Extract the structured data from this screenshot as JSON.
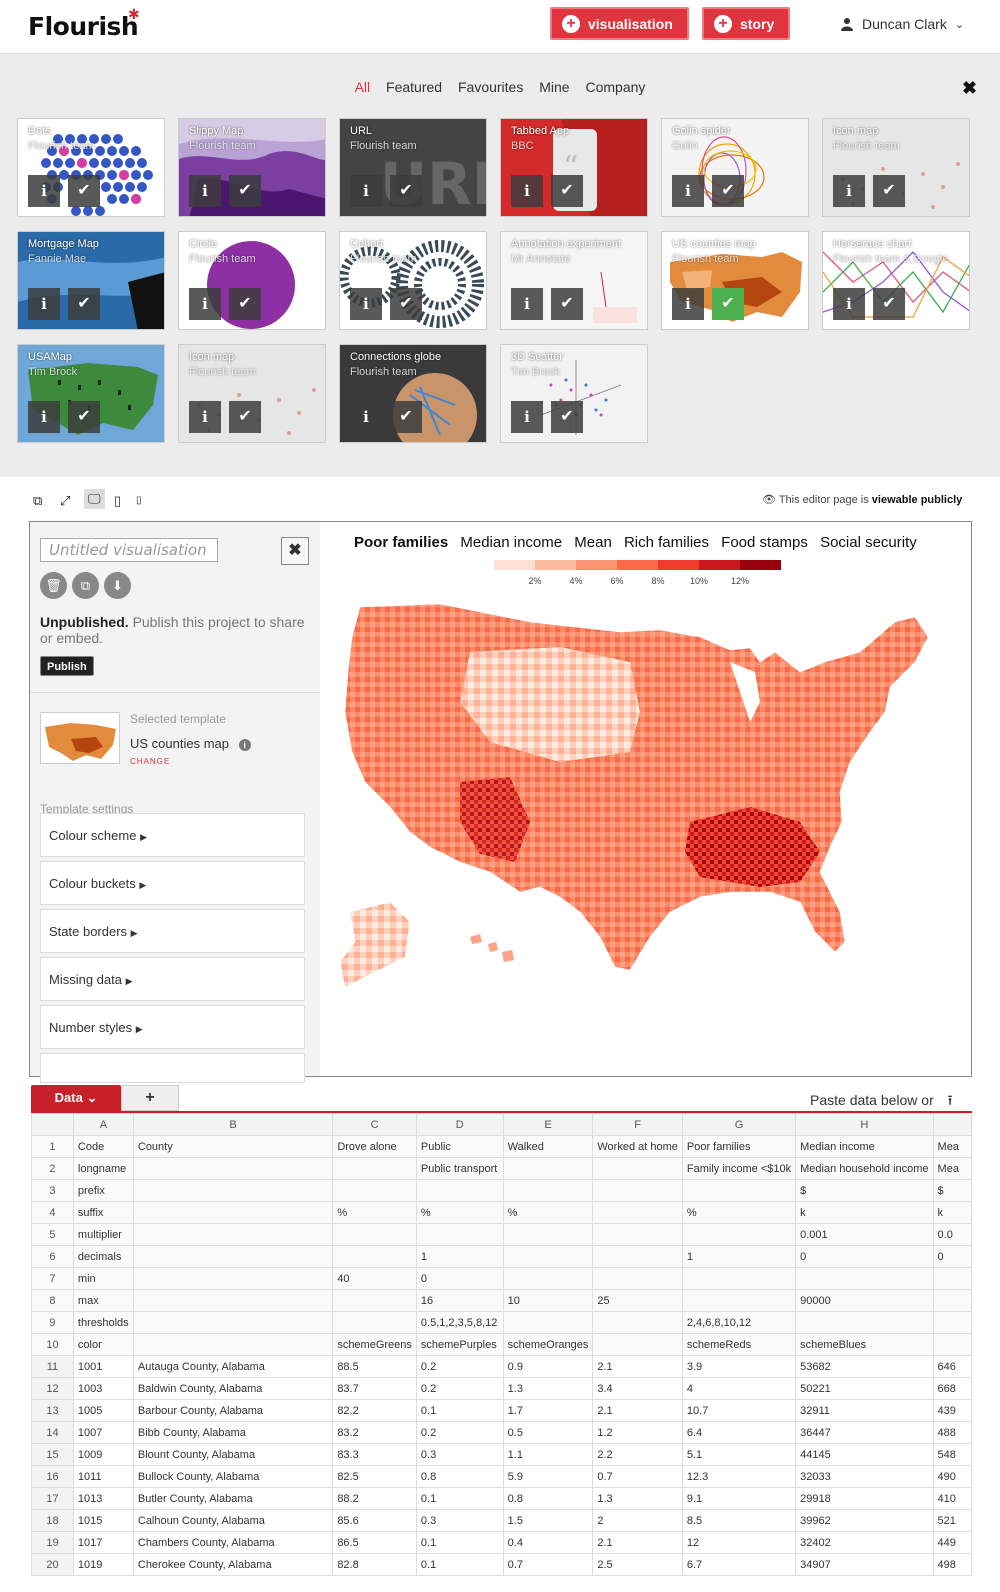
{
  "header": {
    "logo": "Flourish",
    "new_vis_label": "visualisation",
    "new_story_label": "story",
    "user_name": "Duncan Clark"
  },
  "gallery": {
    "filters": [
      "All",
      "Featured",
      "Favourites",
      "Mine",
      "Company"
    ],
    "active_filter": "All",
    "templates": [
      {
        "name": "Dots",
        "author": "Flourish team"
      },
      {
        "name": "Slippy Map",
        "author": "Flourish team"
      },
      {
        "name": "URL",
        "author": "Flourish team"
      },
      {
        "name": "Tabbed App",
        "author": "BBC"
      },
      {
        "name": "Golin spider",
        "author": "Golin"
      },
      {
        "name": "Icon map",
        "author": "Flourish team"
      },
      {
        "name": "Mortgage Map",
        "author": "Fannie Mae"
      },
      {
        "name": "Circle",
        "author": "Flourish team"
      },
      {
        "name": "Cohort",
        "author": "Flourish team"
      },
      {
        "name": "Annotation experiment",
        "author": "Mr Annotate"
      },
      {
        "name": "US counties map",
        "author": "Flourish team"
      },
      {
        "name": "Horserace chart",
        "author": "Flourish team & Google"
      },
      {
        "name": "USAMap",
        "author": "Tim Brock"
      },
      {
        "name": "Icon map",
        "author": "Flourish team"
      },
      {
        "name": "Connections globe",
        "author": "Flourish team"
      },
      {
        "name": "3D Scatter",
        "author": "Tim Brock"
      }
    ]
  },
  "toolbar": {
    "public_prefix": "This editor page is",
    "public_strong": "viewable publicly"
  },
  "editor": {
    "title_placeholder": "Untitled visualisation",
    "unpublished_strong": "Unpublished.",
    "unpublished_text": "Publish this project to share or embed.",
    "publish_label": "Publish",
    "selected_template_label": "Selected template",
    "selected_template_name": "US counties map",
    "change_label": "CHANGE",
    "template_settings_label": "Template settings",
    "settings": [
      "Colour scheme",
      "Colour buckets",
      "State borders",
      "Missing data",
      "Number styles"
    ]
  },
  "preview": {
    "tabs": [
      "Poor families",
      "Median income",
      "Mean",
      "Rich families",
      "Food stamps",
      "Social security"
    ],
    "active_tab": "Poor families",
    "legend_labels": [
      "2%",
      "4%",
      "6%",
      "8%",
      "10%",
      "12%"
    ],
    "legend_colors": [
      "#fde0d2",
      "#fcbba1",
      "#fc9272",
      "#fb6a4a",
      "#ef3b2c",
      "#cb181d",
      "#99000d"
    ]
  },
  "data_tabs": {
    "data_label": "Data",
    "add_label": "+",
    "paste_label": "Paste data below or"
  },
  "grid": {
    "columns": [
      "A",
      "B",
      "C",
      "D",
      "E",
      "F",
      "G",
      "H",
      ""
    ],
    "rows": [
      [
        "1",
        "Code",
        "County",
        "Drove alone",
        "Public",
        "Walked",
        "Worked at home",
        "Poor families",
        "Median income",
        "Mea"
      ],
      [
        "2",
        "longname",
        "",
        "",
        "Public transport",
        "",
        "",
        "Family income <$10k",
        "Median household income",
        "Mea"
      ],
      [
        "3",
        "prefix",
        "",
        "",
        "",
        "",
        "",
        "",
        "$",
        "$"
      ],
      [
        "4",
        "suffix",
        "",
        "%",
        "%",
        "%",
        "",
        "%",
        "k",
        "k"
      ],
      [
        "5",
        "multiplier",
        "",
        "",
        "",
        "",
        "",
        "",
        "0.001",
        "0.0"
      ],
      [
        "6",
        "decimals",
        "",
        "",
        "1",
        "",
        "",
        "1",
        "0",
        "0"
      ],
      [
        "7",
        "min",
        "",
        "40",
        "0",
        "",
        "",
        "",
        "",
        ""
      ],
      [
        "8",
        "max",
        "",
        "",
        "16",
        "10",
        "25",
        "",
        "90000",
        ""
      ],
      [
        "9",
        "thresholds",
        "",
        "",
        "0.5,1,2,3,5,8,12",
        "",
        "",
        "2,4,6,8,10,12",
        "",
        ""
      ],
      [
        "10",
        "color",
        "",
        "schemeGreens",
        "schemePurples",
        "schemeOranges",
        "",
        "schemeReds",
        "schemeBlues",
        ""
      ],
      [
        "11",
        "1001",
        "Autauga County, Alabama",
        "88.5",
        "0.2",
        "0.9",
        "2.1",
        "3.9",
        "53682",
        "646"
      ],
      [
        "12",
        "1003",
        "Baldwin County, Alabama",
        "83.7",
        "0.2",
        "1.3",
        "3.4",
        "4",
        "50221",
        "668"
      ],
      [
        "13",
        "1005",
        "Barbour County, Alabama",
        "82.2",
        "0.1",
        "1.7",
        "2.1",
        "10.7",
        "32911",
        "439"
      ],
      [
        "14",
        "1007",
        "Bibb County, Alabama",
        "83.2",
        "0.2",
        "0.5",
        "1.2",
        "6.4",
        "36447",
        "488"
      ],
      [
        "15",
        "1009",
        "Blount County, Alabama",
        "83.3",
        "0.3",
        "1.1",
        "2.2",
        "5.1",
        "44145",
        "548"
      ],
      [
        "16",
        "1011",
        "Bullock County, Alabama",
        "82.5",
        "0.8",
        "5.9",
        "0.7",
        "12.3",
        "32033",
        "490"
      ],
      [
        "17",
        "1013",
        "Butler County, Alabama",
        "88.2",
        "0.1",
        "0.8",
        "1.3",
        "9.1",
        "29918",
        "410"
      ],
      [
        "18",
        "1015",
        "Calhoun County, Alabama",
        "85.6",
        "0.3",
        "1.5",
        "2",
        "8.5",
        "39962",
        "521"
      ],
      [
        "19",
        "1017",
        "Chambers County, Alabama",
        "86.5",
        "0.1",
        "0.4",
        "2.1",
        "12",
        "32402",
        "449"
      ],
      [
        "20",
        "1019",
        "Cherokee County, Alabama",
        "82.8",
        "0.1",
        "0.7",
        "2.5",
        "6.7",
        "34907",
        "498"
      ]
    ]
  }
}
